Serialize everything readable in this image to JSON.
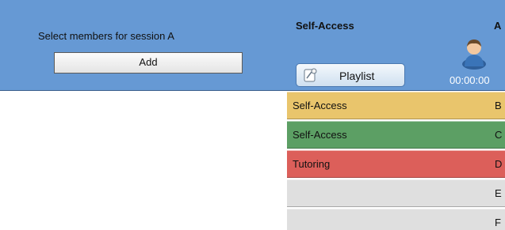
{
  "members": {
    "label": "Select members for session  A",
    "add_label": "Add"
  },
  "session": {
    "title": "Self-Access",
    "playlist_label": "Playlist",
    "station_letter": "A",
    "timer": "00:00:00",
    "avatar_icon": "user-avatar-icon",
    "playlist_icon": "playlist-icon"
  },
  "colors": {
    "panel": "#6699d4",
    "self_access_yellow": "#e9c56c",
    "self_access_green": "#5c9f64",
    "tutoring_red": "#dc5f5a",
    "empty_gray": "#dfdfdf"
  },
  "stations": [
    {
      "session": "Self-Access",
      "id": "B",
      "color": "#e9c56c"
    },
    {
      "session": "Self-Access",
      "id": "C",
      "color": "#5c9f64"
    },
    {
      "session": "Tutoring",
      "id": "D",
      "color": "#dc5f5a"
    },
    {
      "session": "",
      "id": "E",
      "color": "#dfdfdf"
    },
    {
      "session": "",
      "id": "F",
      "color": "#dfdfdf"
    }
  ]
}
